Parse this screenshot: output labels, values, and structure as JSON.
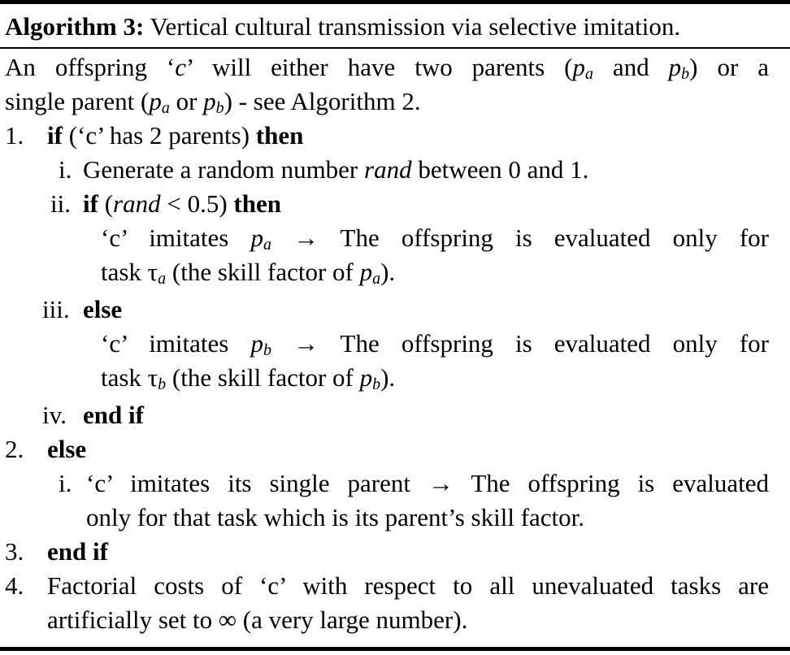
{
  "algorithm": {
    "label": "Algorithm 3:",
    "title": "Vertical cultural transmission via selective imitation."
  },
  "intro": {
    "l1_a": "An offspring ‘",
    "c": "c",
    "l1_b": "’ will either have two parents (",
    "pa": "p",
    "sub_a": "a",
    "and": " and ",
    "pb": "p",
    "sub_b": "b",
    "l1_c": ")  or a",
    "l2_a": "single parent  (",
    "or": " or ",
    "l2_b": ") - see Algorithm 2."
  },
  "steps": {
    "n1": "1.",
    "if_kw": "if",
    "s1_text": " (‘c’  has 2 parents) ",
    "then_kw": "then",
    "n1i": "i.",
    "s1i_a": "Generate a random number ",
    "rand": "rand",
    "s1i_b": " between 0 and 1.",
    "n1ii": "ii.",
    "s1ii_a": " (",
    "s1ii_b": " < 0.5) ",
    "imit_a1": "‘c’ imitates ",
    "arrow_text": " → The offspring is evaluated only for",
    "task_a1": "task τ",
    "task_a2": " (the skill factor of ",
    "task_a3": ").",
    "n1iii": "iii.",
    "else_kw": "else",
    "n1iv": "iv.",
    "endif_kw": "end if",
    "n2": "2.",
    "n2i": "i.",
    "s2i_l1": "‘c’ imitates its single parent → The offspring is evaluated",
    "s2i_l2": "only for that task which is its parent’s skill factor.",
    "n3": "3.",
    "n4": "4.",
    "s4_l1": "Factorial costs of ‘c’ with respect to all unevaluated tasks are",
    "s4_l2": "artificially set to ∞ (a very large number)."
  }
}
